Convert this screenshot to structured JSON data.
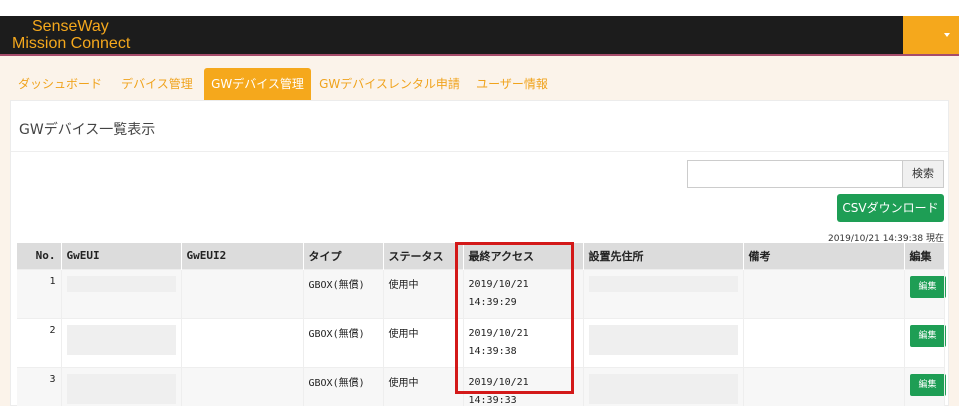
{
  "brand": {
    "line1": "SenseWay",
    "line2": "Mission Connect"
  },
  "tabs": [
    {
      "label": "ダッシュボード",
      "active": false
    },
    {
      "label": "デバイス管理",
      "active": false
    },
    {
      "label": "GWデバイス管理",
      "active": true
    },
    {
      "label": "GWデバイスレンタル申請",
      "active": false
    },
    {
      "label": "ユーザー情報",
      "active": false
    }
  ],
  "panel": {
    "title": "GWデバイス一覧表示",
    "search_placeholder": "",
    "search_button": "検索",
    "csv_button": "CSVダウンロード",
    "timestamp": "2019/10/21 14:39:38 現在"
  },
  "table": {
    "headers": [
      "No.",
      "GwEUI",
      "GwEUI2",
      "タイプ",
      "ステータス",
      "最終アクセス",
      "設置先住所",
      "備考",
      "編集"
    ],
    "rows": [
      {
        "no": "1",
        "type": "GBOX(無償)",
        "status": "使用中",
        "access_date": "2019/10/21",
        "access_time": "14:39:29",
        "edit": "編集"
      },
      {
        "no": "2",
        "type": "GBOX(無償)",
        "status": "使用中",
        "access_date": "2019/10/21",
        "access_time": "14:39:38",
        "edit": "編集"
      },
      {
        "no": "3",
        "type": "GBOX(無償)",
        "status": "使用中",
        "access_date": "2019/10/21",
        "access_time": "14:39:33",
        "edit": "編集"
      }
    ]
  },
  "colors": {
    "accent": "#f5a81c",
    "success": "#1e9e55",
    "highlight": "#d31919",
    "topbar": "#1c1c1c"
  }
}
